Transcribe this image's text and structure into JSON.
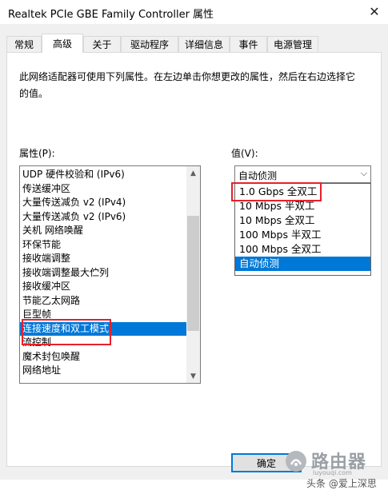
{
  "window": {
    "title": "Realtek PCIe GBE Family Controller 属性",
    "close_glyph": "✕"
  },
  "tabs": [
    {
      "label": "常规",
      "active": false
    },
    {
      "label": "高级",
      "active": true
    },
    {
      "label": "关于",
      "active": false
    },
    {
      "label": "驱动程序",
      "active": false
    },
    {
      "label": "详细信息",
      "active": false
    },
    {
      "label": "事件",
      "active": false
    },
    {
      "label": "电源管理",
      "active": false
    }
  ],
  "advanced": {
    "description": "此网络适配器可使用下列属性。在左边单击你想更改的属性，然后在右边选择它的值。",
    "property_label": "属性(P):",
    "value_label": "值(V):",
    "properties": [
      {
        "label": "UDP 硬件校验和 (IPv6)",
        "selected": false
      },
      {
        "label": "传送缓冲区",
        "selected": false
      },
      {
        "label": "大量传送减负 v2 (IPv4)",
        "selected": false
      },
      {
        "label": "大量传送减负 v2 (IPv6)",
        "selected": false
      },
      {
        "label": "关机 网络唤醒",
        "selected": false
      },
      {
        "label": "环保节能",
        "selected": false
      },
      {
        "label": "接收端调整",
        "selected": false
      },
      {
        "label": "接收端调整最大伫列",
        "selected": false
      },
      {
        "label": "接收缓冲区",
        "selected": false
      },
      {
        "label": "节能乙太网路",
        "selected": false
      },
      {
        "label": "巨型帧",
        "selected": false
      },
      {
        "label": "连接速度和双工模式",
        "selected": true
      },
      {
        "label": "流控制",
        "selected": false
      },
      {
        "label": "魔术封包唤醒",
        "selected": false
      },
      {
        "label": "网络地址",
        "selected": false
      }
    ],
    "value_combo": {
      "selected": "自动侦测",
      "options": [
        {
          "label": "1.0 Gbps 全双工",
          "selected": false
        },
        {
          "label": "10 Mbps 半双工",
          "selected": false
        },
        {
          "label": "10 Mbps 全双工",
          "selected": false
        },
        {
          "label": "100 Mbps 半双工",
          "selected": false
        },
        {
          "label": "100 Mbps 全双工",
          "selected": false
        },
        {
          "label": "自动侦测",
          "selected": true
        }
      ]
    }
  },
  "buttons": {
    "ok": "确定"
  },
  "watermark": {
    "logo_text": "路由器",
    "url": "luyouqi.com",
    "caption": "头条 @爱上深思"
  },
  "colors": {
    "selection": "#0078d7",
    "highlight_box": "#e8202a"
  }
}
